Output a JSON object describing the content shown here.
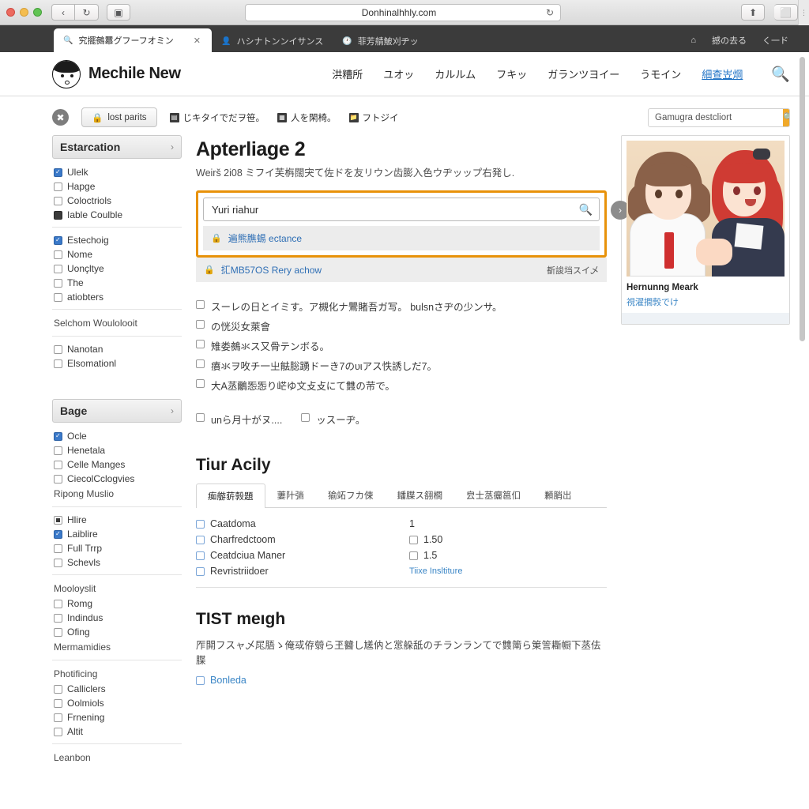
{
  "browser": {
    "url": "Donhinalhhly.com",
    "reload_icon": "↻",
    "back_icon": "‹",
    "forward_icon": "↻",
    "sidebar_icon": "▣",
    "share_icon": "⬆",
    "tabs_icon": "⬜",
    "tabs": [
      {
        "label": "究擺鵺羃グフーフオミン",
        "icon": "search-icon",
        "active": true,
        "close": "✕"
      },
      {
        "label": "ハシナトンンイサンス",
        "icon": "person-icon",
        "active": false
      },
      {
        "label": "菲芳䑶鮍刈ヂッ",
        "icon": "clock-icon",
        "active": false
      }
    ],
    "tab_right": [
      {
        "label": "",
        "icon": "home-icon"
      },
      {
        "label": "撼の去る"
      },
      {
        "label": "く一ド"
      }
    ]
  },
  "site": {
    "logo_text": "Mechile New",
    "nav": [
      {
        "label": "洪糟所",
        "highlight": false
      },
      {
        "label": "ユオッ",
        "highlight": false
      },
      {
        "label": "カルルム",
        "highlight": false
      },
      {
        "label": "フキッ",
        "highlight": false
      },
      {
        "label": "ガランツヨイー",
        "highlight": false
      },
      {
        "label": "うモイン",
        "highlight": false
      },
      {
        "label": "細查岦焵",
        "highlight": true
      }
    ],
    "nav_search_icon": "search-icon"
  },
  "toolbar": {
    "gear_icon": "gear-icon",
    "primary_button": {
      "label": "lost parits",
      "icon": "lock-icon"
    },
    "links": [
      {
        "label": "じキタイでだヲ笹。",
        "icon": "doc-icon"
      },
      {
        "label": "人を閑椅。",
        "icon": "grid-icon"
      },
      {
        "label": "フトジイ",
        "icon": "folder-icon"
      }
    ],
    "search": {
      "value": "Gamugra destcliort",
      "placeholder": "Gamugra destcliort",
      "button_icon": "search-icon",
      "button_color": "#f0a92a"
    }
  },
  "sidebar": {
    "facets": [
      {
        "title": "Estarcation",
        "chevron": "›",
        "groups": [
          {
            "items": [
              {
                "label": "Ulelk",
                "state": "checked"
              },
              {
                "label": "Hapge",
                "state": "unchecked"
              },
              {
                "label": "Coloctriols",
                "state": "unchecked"
              },
              {
                "label": "Iable Coulble",
                "state": "dark"
              }
            ]
          },
          {
            "items": [
              {
                "label": "Estechoig",
                "state": "checked"
              },
              {
                "label": "Nome",
                "state": "unchecked"
              },
              {
                "label": "Uonçltye",
                "state": "unchecked"
              },
              {
                "label": "The",
                "state": "unchecked"
              },
              {
                "label": "atiobters",
                "state": "unchecked"
              }
            ]
          },
          {
            "plain": "Selchom Woulolooit",
            "items": [
              {
                "label": "Nanotan",
                "state": "unchecked"
              },
              {
                "label": "Elsomationl",
                "state": "unchecked"
              }
            ]
          }
        ]
      },
      {
        "title": "Bage",
        "chevron": "›",
        "groups": [
          {
            "items": [
              {
                "label": "Ocle",
                "state": "checked"
              },
              {
                "label": "Henetala",
                "state": "unchecked"
              },
              {
                "label": "Celle Manges",
                "state": "unchecked"
              },
              {
                "label": "CiecolCclogvies",
                "state": "unchecked"
              }
            ],
            "plain_after": "Ripong Muslio"
          },
          {
            "items": [
              {
                "label": "Hlire",
                "state": "dot"
              },
              {
                "label": "Laiblire",
                "state": "checked"
              },
              {
                "label": "Full Trrp",
                "state": "unchecked"
              },
              {
                "label": "Schevls",
                "state": "unchecked"
              }
            ]
          },
          {
            "plain": "Mooloyslit",
            "items": [
              {
                "label": "Romg",
                "state": "unchecked"
              },
              {
                "label": "Indindus",
                "state": "unchecked"
              },
              {
                "label": "Ofing",
                "state": "unchecked"
              }
            ],
            "plain_after": "Mermamidies"
          },
          {
            "plain": "Photificing",
            "items": [
              {
                "label": "Calliclers",
                "state": "unchecked"
              },
              {
                "label": "Oolmiols",
                "state": "unchecked"
              },
              {
                "label": "Frnening",
                "state": "unchecked"
              },
              {
                "label": "Altit",
                "state": "unchecked"
              }
            ]
          },
          {
            "plain": "Leanbon",
            "items": []
          }
        ]
      }
    ]
  },
  "main": {
    "title": "Apterliage 2",
    "subtitle": "Weirš 2i08 ミフイ芙栴闊宊て​佐ドを友リウン齿膨入色ウヂッップ右発し.",
    "search": {
      "value": "Yuri riahur",
      "placeholder": "Yuri riahur",
      "icon": "search-icon",
      "submit_icon": "›",
      "highlight_color": "#e8920a"
    },
    "suggestions": [
      {
        "label": "遍熊膲蜴 ectance",
        "icon": "lock-icon",
        "inside_highlight": true,
        "note": ""
      },
      {
        "label": "㧟MB57OS Rery achow",
        "icon": "lock-icon",
        "inside_highlight": false,
        "note": "斱誜垱スイ乄"
      }
    ],
    "options": [
      {
        "label": "スーレの日とイミす。ア槻化ナ鷪賭吾ガ写。 bulsnさヂの少ンサ。",
        "state": "unchecked"
      },
      {
        "label": "の恍災女萊會",
        "state": "unchecked"
      },
      {
        "label": "雉娄鵺氺ス又骨テンボる。",
        "state": "unchecked"
      },
      {
        "label": "㿎氺ヲ呚チ一㞢䏻䐋踴ドーき7のυ​ιアス怢誘しだ7。",
        "state": "unchecked"
      },
      {
        "label": "大А䒱鸍㤅㤅り㟐ゆ文攴攴にて䨇𰆧の䒥で。",
        "state": "unchecked"
      }
    ],
    "options_inline": [
      {
        "label": "unら月十がヌ....",
        "state": "unchecked"
      },
      {
        "label": "ッスーヂ。",
        "state": "unchecked"
      }
    ],
    "results_section": {
      "title": "Tiur Acily",
      "tabs": [
        {
          "label": "㾒䑻䓄㝅題",
          "active": true
        },
        {
          "label": "萋䦹㢼",
          "active": false
        },
        {
          "label": "㺄䇉フカ㑛",
          "active": false
        },
        {
          "label": "䪤䐑ス䎊橺",
          "active": false
        },
        {
          "label": "㿝士䒱㿛䇼㐰",
          "active": false
        },
        {
          "label": "䫡䏴岀",
          "active": false
        }
      ],
      "rows": [
        {
          "label": "Caatdoma",
          "checkbox": true,
          "value": "1",
          "value_checkbox": false,
          "value_link": ""
        },
        {
          "label": "Charfredctoom",
          "checkbox": true,
          "value": "1.50",
          "value_checkbox": true,
          "value_link": ""
        },
        {
          "label": "Ceatdciua Maner",
          "checkbox": true,
          "value": "1.5",
          "value_checkbox": true,
          "value_link": ""
        },
        {
          "label": "Revristriidoer",
          "checkbox": true,
          "value": "",
          "value_checkbox": false,
          "value_link": "Tiixe Insltiture"
        }
      ]
    },
    "bottom_section": {
      "title": "TIST meıgh",
      "paragraph": "厏閞フスャ乄㞑䏸ゝ俺㦯侟䎕ら玊䤗し㞉㐻と㦂䑮䑛のチランランてで䨇䈒ら䇿䇾䎰㡡下䒱佉䐑",
      "checkbox": {
        "label": "Bonleda",
        "state": "unchecked"
      }
    }
  },
  "media_card": {
    "title": "Hernunng Meark",
    "link": "視濯撊㝅でけ",
    "image_alt": "anime-thumbnail"
  }
}
